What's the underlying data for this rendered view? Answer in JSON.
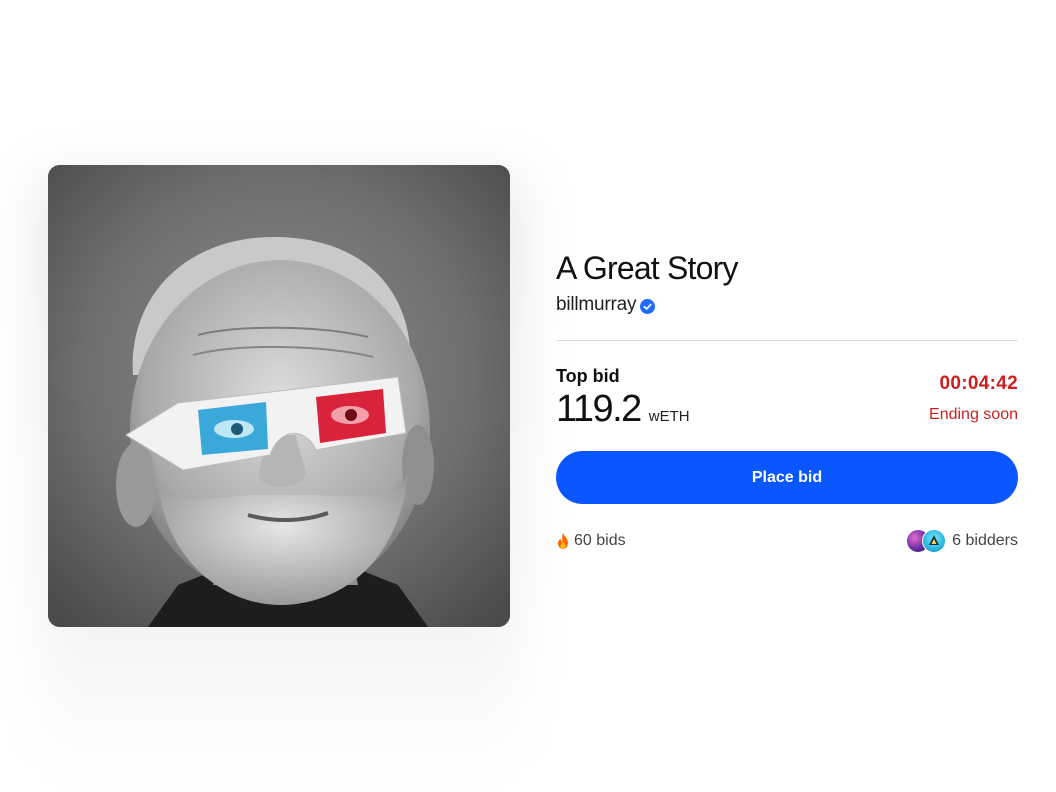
{
  "artwork": {
    "icon": "portrait-3d-glasses-image",
    "colors": {
      "background": "#6f6f6f",
      "lens_left": "#3aa8d8",
      "lens_right": "#d8233a"
    }
  },
  "item": {
    "title": "A Great Story",
    "creator": "billmurray",
    "verified_icon": "verified-check-icon"
  },
  "auction": {
    "top_bid_label": "Top bid",
    "amount": "119.2",
    "currency": "wETH",
    "countdown": "00:04:42",
    "status": "Ending soon",
    "place_bid_label": "Place bid",
    "bids_count": "60 bids",
    "bidders_count": "6 bidders"
  },
  "colors": {
    "accent": "#0a57ff",
    "urgent": "#cc1f1f"
  }
}
